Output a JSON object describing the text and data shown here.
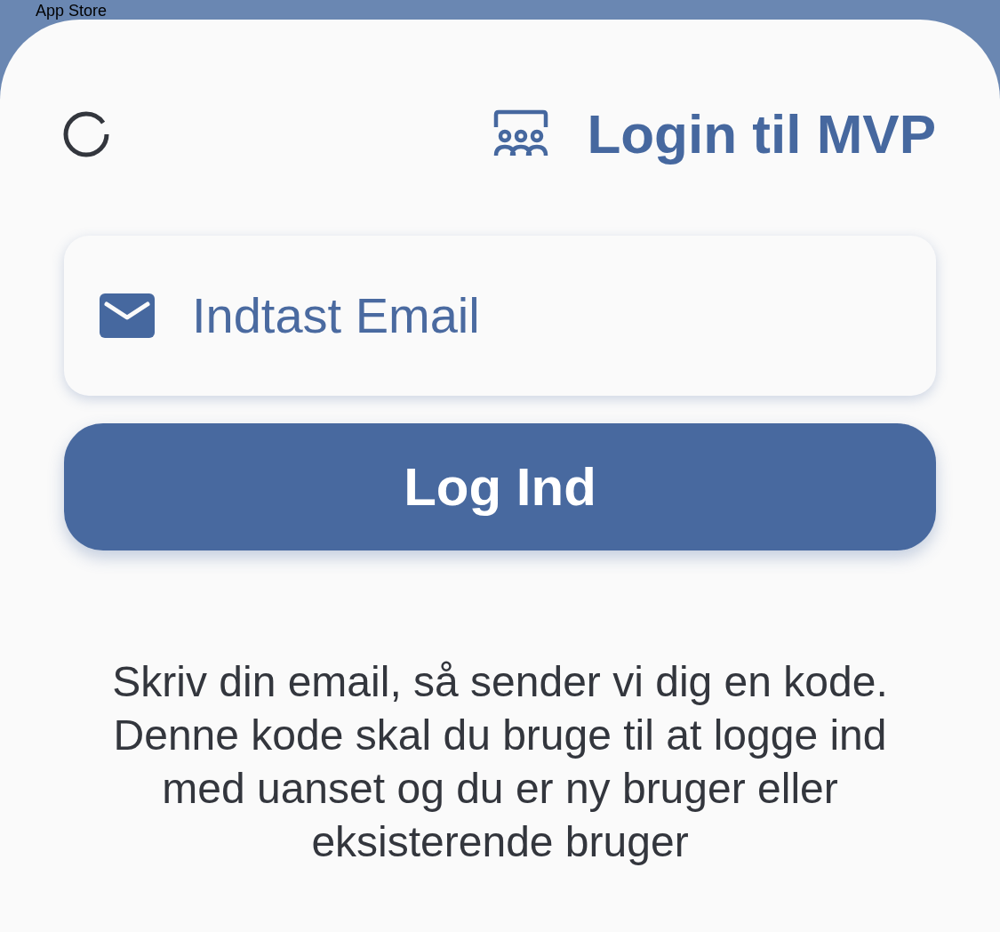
{
  "status_bar": {
    "back_label": "App Store"
  },
  "header": {
    "title": "Login til MVP"
  },
  "email_field": {
    "placeholder": "Indtast Email"
  },
  "login_button": {
    "label": "Log Ind"
  },
  "info_text": "Skriv din email, så sender vi dig en kode. Denne kode skal du bruge til at logge ind med uanset og du er ny bruger eller eksisterende bruger"
}
